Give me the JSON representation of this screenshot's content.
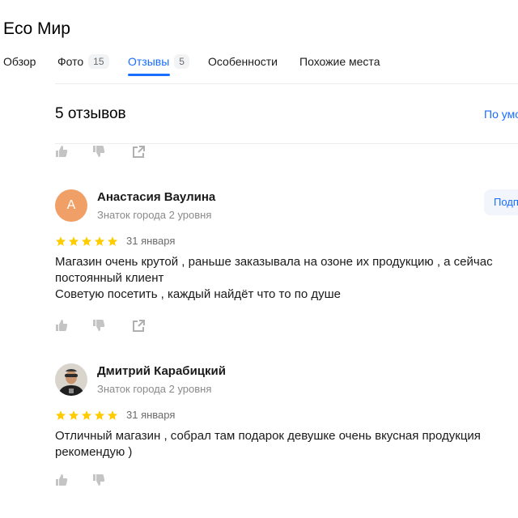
{
  "place": {
    "title": "Eco Мир"
  },
  "tabs": [
    {
      "label": "Обзор",
      "count": ""
    },
    {
      "label": "Фото",
      "count": "15"
    },
    {
      "label": "Отзывы",
      "count": "5"
    },
    {
      "label": "Особенности",
      "count": ""
    },
    {
      "label": "Похожие места",
      "count": ""
    }
  ],
  "reviews_section": {
    "heading": "5 отзывов",
    "sort_label": "По умо"
  },
  "reviews": [
    {
      "avatar_letter": "А",
      "author": "Анастасия Ваулина",
      "rank": "Знаток города 2 уровня",
      "subscribe_label": "Подп",
      "rating": 5,
      "date": "31 января",
      "text_lines": [
        "Магазин очень крутой , раньше заказывала на озоне их продукцию , а сейчас",
        "постоянный клиент",
        "Советую посетить , каждый найдёт что то по душе"
      ]
    },
    {
      "author": "Дмитрий Карабицкий",
      "rank": "Знаток города 2 уровня",
      "rating": 5,
      "date": "31 января",
      "text_lines": [
        "Отличный магазин , собрал там подарок девушке очень вкусная продукция",
        "рекомендую )"
      ]
    }
  ],
  "icons": {
    "like": "thumbs-up-icon",
    "dislike": "thumbs-down-icon",
    "share": "share-icon",
    "star": "star-icon"
  },
  "colors": {
    "accent": "#196dff",
    "star": "#ffcc00",
    "avatar_bg": "#f0a066"
  }
}
